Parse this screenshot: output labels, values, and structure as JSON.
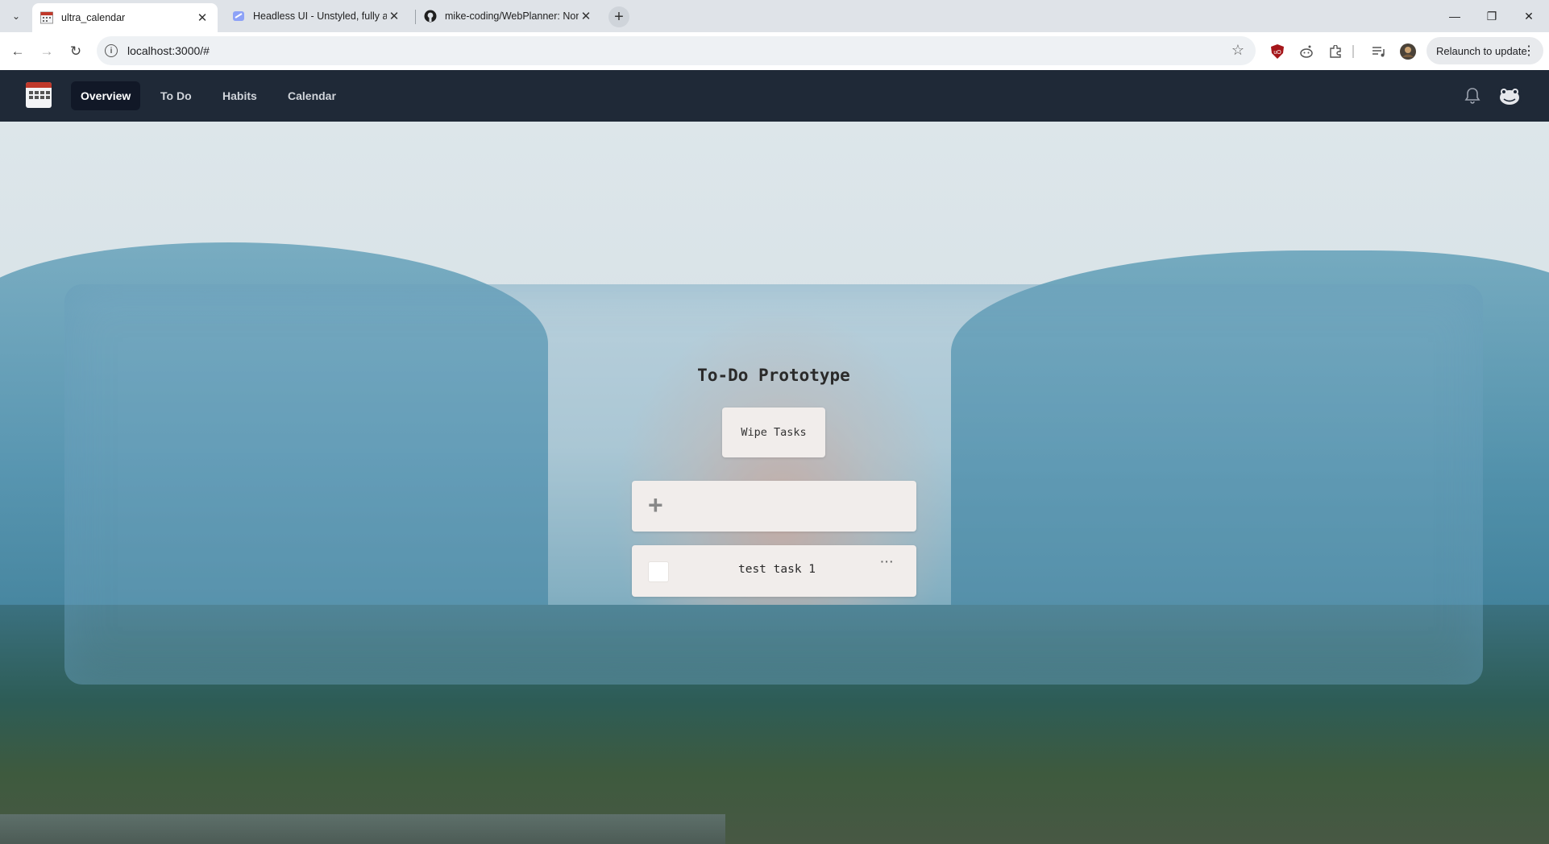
{
  "browser": {
    "tabs": [
      {
        "title": "ultra_calendar",
        "active": true
      },
      {
        "title": "Headless UI - Unstyled, fully acc",
        "active": false
      },
      {
        "title": "mike-coding/WebPlanner: Non",
        "active": false
      }
    ],
    "url": "localhost:3000/#",
    "relaunch_label": "Relaunch to update",
    "icons": {
      "back": "back-arrow-icon",
      "forward": "forward-arrow-icon",
      "reload": "reload-icon",
      "bookmark": "star-icon"
    }
  },
  "app": {
    "nav": {
      "items": [
        {
          "label": "Overview",
          "active": true
        },
        {
          "label": "To Do",
          "active": false
        },
        {
          "label": "Habits",
          "active": false
        },
        {
          "label": "Calendar",
          "active": false
        }
      ]
    },
    "colors": {
      "nav_bg": "#1f2937",
      "nav_active_bg": "#111827",
      "card_bg": "#f1edeb"
    }
  },
  "todo": {
    "title": "To-Do Prototype",
    "wipe_label": "Wipe Tasks",
    "new_task_placeholder": "",
    "tasks": [
      {
        "label": "test task 1",
        "done": false,
        "menu_label": "···"
      }
    ]
  }
}
